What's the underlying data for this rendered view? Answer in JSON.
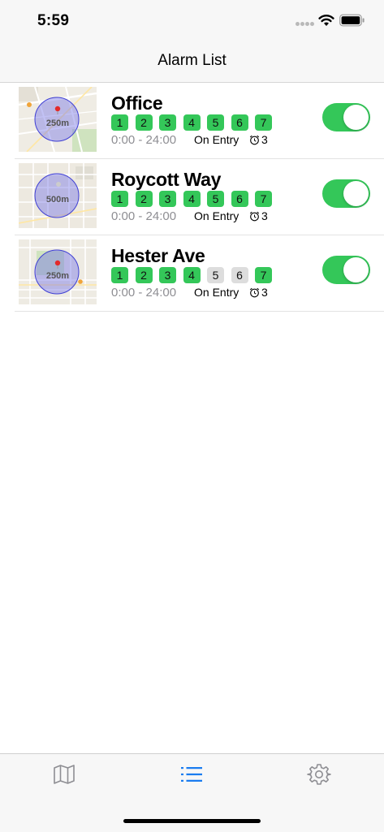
{
  "status_bar": {
    "time": "5:59"
  },
  "nav": {
    "title": "Alarm List"
  },
  "alarms": [
    {
      "name": "Office",
      "radius": "250m",
      "days": [
        {
          "label": "1",
          "active": true
        },
        {
          "label": "2",
          "active": true
        },
        {
          "label": "3",
          "active": true
        },
        {
          "label": "4",
          "active": true
        },
        {
          "label": "5",
          "active": true
        },
        {
          "label": "6",
          "active": true
        },
        {
          "label": "7",
          "active": true
        }
      ],
      "time_range": "0:00 - 24:00",
      "trigger": "On Entry",
      "count": "3",
      "enabled": true
    },
    {
      "name": "Roycott Way",
      "radius": "500m",
      "days": [
        {
          "label": "1",
          "active": true
        },
        {
          "label": "2",
          "active": true
        },
        {
          "label": "3",
          "active": true
        },
        {
          "label": "4",
          "active": true
        },
        {
          "label": "5",
          "active": true
        },
        {
          "label": "6",
          "active": true
        },
        {
          "label": "7",
          "active": true
        }
      ],
      "time_range": "0:00 - 24:00",
      "trigger": "On Entry",
      "count": "3",
      "enabled": true
    },
    {
      "name": "Hester Ave",
      "radius": "250m",
      "days": [
        {
          "label": "1",
          "active": true
        },
        {
          "label": "2",
          "active": true
        },
        {
          "label": "3",
          "active": true
        },
        {
          "label": "4",
          "active": true
        },
        {
          "label": "5",
          "active": false
        },
        {
          "label": "6",
          "active": false
        },
        {
          "label": "7",
          "active": true
        }
      ],
      "time_range": "0:00 - 24:00",
      "trigger": "On Entry",
      "count": "3",
      "enabled": true
    }
  ],
  "tab_bar": {
    "tabs": [
      {
        "icon": "map-icon",
        "selected": false
      },
      {
        "icon": "list-icon",
        "selected": true
      },
      {
        "icon": "gear-icon",
        "selected": false
      }
    ]
  },
  "colors": {
    "accent": "#34c759",
    "tab_selected": "#1a7cf0",
    "tab_unselected": "#8e8e93",
    "day_inactive": "#dddddd"
  }
}
